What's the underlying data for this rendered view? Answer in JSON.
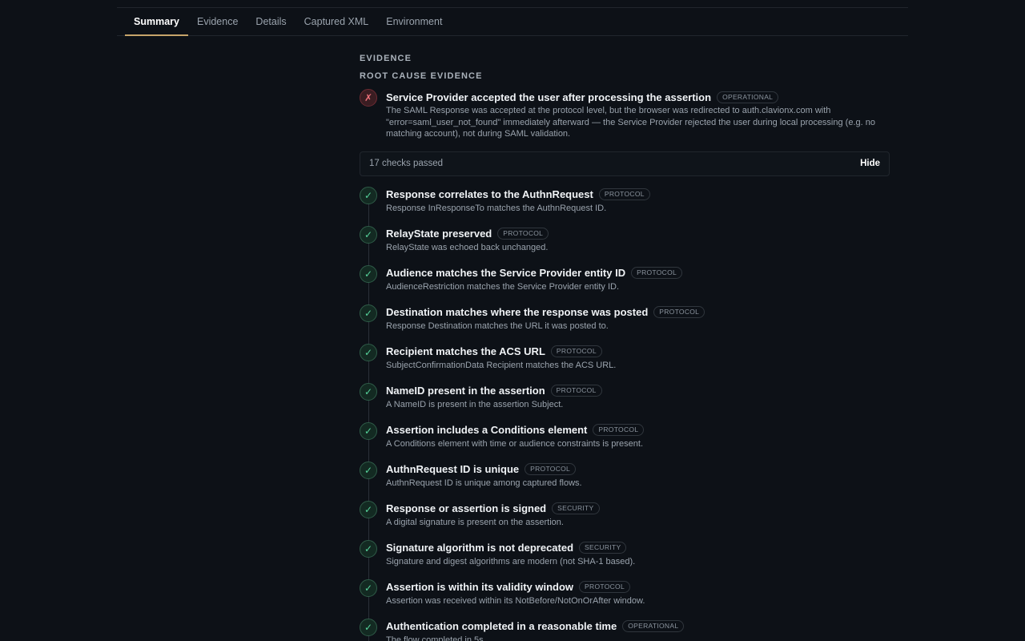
{
  "tabs": [
    "Summary",
    "Evidence",
    "Details",
    "Captured XML",
    "Environment"
  ],
  "active_tab": "Summary",
  "section": {
    "title": "EVIDENCE",
    "subtitle": "ROOT CAUSE EVIDENCE"
  },
  "root_cause": {
    "status_icon": "x-icon",
    "status_glyph": "✗",
    "title": "Service Provider accepted the user after processing the assertion",
    "badge": "OPERATIONAL",
    "description": "The SAML Response was accepted at the protocol level, but the browser was redirected to auth.clavionx.com with \"error=saml_user_not_found\" immediately afterward — the Service Provider rejected the user during local processing (e.g. no matching account), not during SAML validation."
  },
  "passed_summary": {
    "label": "17 checks passed",
    "toggle_label": "Hide"
  },
  "pass_glyph": "✓",
  "checks": [
    {
      "title": "Response correlates to the AuthnRequest",
      "badge": "PROTOCOL",
      "description": "Response InResponseTo matches the AuthnRequest ID."
    },
    {
      "title": "RelayState preserved",
      "badge": "PROTOCOL",
      "description": "RelayState was echoed back unchanged."
    },
    {
      "title": "Audience matches the Service Provider entity ID",
      "badge": "PROTOCOL",
      "description": "AudienceRestriction matches the Service Provider entity ID."
    },
    {
      "title": "Destination matches where the response was posted",
      "badge": "PROTOCOL",
      "description": "Response Destination matches the URL it was posted to."
    },
    {
      "title": "Recipient matches the ACS URL",
      "badge": "PROTOCOL",
      "description": "SubjectConfirmationData Recipient matches the ACS URL."
    },
    {
      "title": "NameID present in the assertion",
      "badge": "PROTOCOL",
      "description": "A NameID is present in the assertion Subject."
    },
    {
      "title": "Assertion includes a Conditions element",
      "badge": "PROTOCOL",
      "description": "A Conditions element with time or audience constraints is present."
    },
    {
      "title": "AuthnRequest ID is unique",
      "badge": "PROTOCOL",
      "description": "AuthnRequest ID is unique among captured flows."
    },
    {
      "title": "Response or assertion is signed",
      "badge": "SECURITY",
      "description": "A digital signature is present on the assertion."
    },
    {
      "title": "Signature algorithm is not deprecated",
      "badge": "SECURITY",
      "description": "Signature and digest algorithms are modern (not SHA-1 based)."
    },
    {
      "title": "Assertion is within its validity window",
      "badge": "PROTOCOL",
      "description": "Assertion was received within its NotBefore/NotOnOrAfter window."
    },
    {
      "title": "Authentication completed in a reasonable time",
      "badge": "OPERATIONAL",
      "description": "The flow completed in 5s."
    }
  ]
}
